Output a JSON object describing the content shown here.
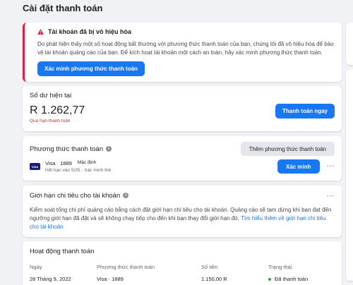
{
  "page": {
    "title": "Cài đặt thanh toán"
  },
  "alert": {
    "title": "Tài khoản đã bị vô hiệu hóa",
    "body": "Do phát hiện thấy một số hoạt động bất thường với phương thức thanh toán của bạn, chúng tôi đã vô hiệu hóa để bảo vệ tài khoản quảng cáo của bạn. Để kích hoạt tài khoản một cách an toàn, hãy xác minh phương thức thanh toán.",
    "button": "Xác minh phương thức thanh toán",
    "accent": "#e41e3f"
  },
  "balance": {
    "title": "Số dư hiện tại",
    "amount": "R 1.262,77",
    "status": "Quá hạn thanh toán",
    "button": "Thanh toán ngay"
  },
  "methods": {
    "title": "Phương thức thanh toán",
    "add_button": "Thêm phương thức thanh toán",
    "card": {
      "brand_logo": "VISA",
      "name": "Visa · 1889",
      "badge": "Mặc định",
      "expiry": "Hết hạn vào 5/25 · Xác minh thẻ",
      "verify_button": "Xác minh",
      "more": "···"
    }
  },
  "limit": {
    "title": "Giới hạn chi tiêu cho tài khoản",
    "more": "···",
    "body": "Kiểm soát tổng chi phí quảng cáo bằng cách đặt giới hạn chi tiêu cho tài khoản. Quảng cáo sẽ tạm dừng khi bạn đạt đến ngưỡng giới hạn đã đặt và sẽ không chạy tiếp cho đến khi bạn thay đổi giới hạn đó.",
    "link": "Tìm hiểu thêm về giới hạn chi tiêu cho tài khoản"
  },
  "activity": {
    "title": "Hoạt động thanh toán",
    "headers": [
      "Ngày",
      "Phương thức thanh toán",
      "Số tiền",
      "Trạng thái"
    ],
    "rows": [
      [
        "28 Tháng 9, 2022",
        "Visa · 1889",
        "1.150,00 R",
        "Đã thanh toán"
      ]
    ]
  },
  "colors": {
    "primary": "#1877f2",
    "success": "#31a24c",
    "danger": "#c0392b"
  },
  "icons": [
    "warning-icon",
    "info-icon",
    "visa-logo",
    "more-icon",
    "status-dot"
  ]
}
